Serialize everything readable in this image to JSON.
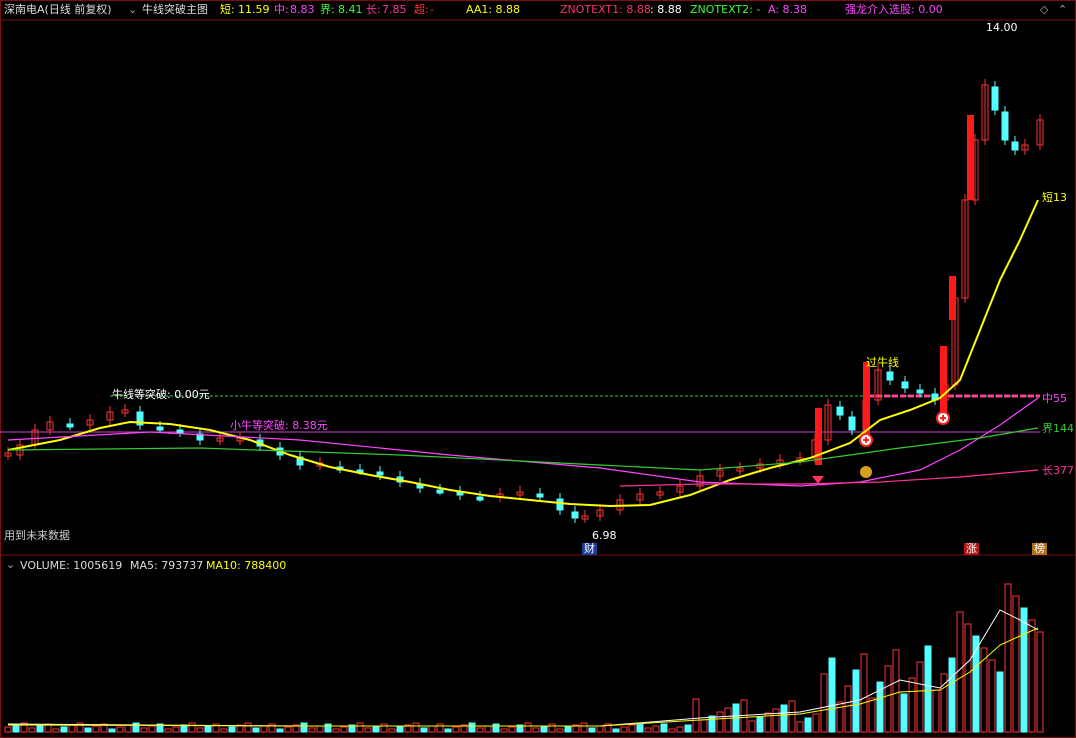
{
  "header": {
    "stock_title": "深南电A(日线 前复权)",
    "indicator_name": "牛线突破主图",
    "short_label": "短:",
    "short_value": "11.59",
    "mid_label": "中:",
    "mid_value": "8.83",
    "bound_label": "界:",
    "bound_value": "8.41",
    "long_label": "长:",
    "long_value": "7.85",
    "super_label": "超:",
    "super_value": "-",
    "aa1": "AA1: 8.88",
    "znotext1_label": "ZNOTEXT1: 8.88",
    "znotext1_value": ": 8.88",
    "znotext2": "ZNOTEXT2: -",
    "a_value": "A: 8.38",
    "dragon": "强龙介入选股: 0.00"
  },
  "main_chart": {
    "high_label": "14.00",
    "low_label": "6.98",
    "bull_break_label": "牛线等突破: 0.00元",
    "small_bull_label": "小牛等突破: 8.38元",
    "bull_line_label": "过牛线",
    "short_tag": "短13",
    "mid_tag": "中55",
    "bound_tag": "界144",
    "long_tag": "长377",
    "future_note": "用到未来数据",
    "cai_tag": "财",
    "zhang_tag": "涨",
    "bang_tag": "榜"
  },
  "volume_panel": {
    "title": "VOLUME: 1005619",
    "ma5": "MA5: 793737",
    "ma10": "MA10: 788400"
  },
  "colors": {
    "up": "#ff3333",
    "down": "#54ffff",
    "short_ma": "#ffff00",
    "mid_ma": "#ff44ff",
    "bound_ma": "#33cc33",
    "long_ma": "#ff3399",
    "header_yellow": "#ffff00",
    "header_red": "#ff3366",
    "header_green": "#33ff33"
  }
}
